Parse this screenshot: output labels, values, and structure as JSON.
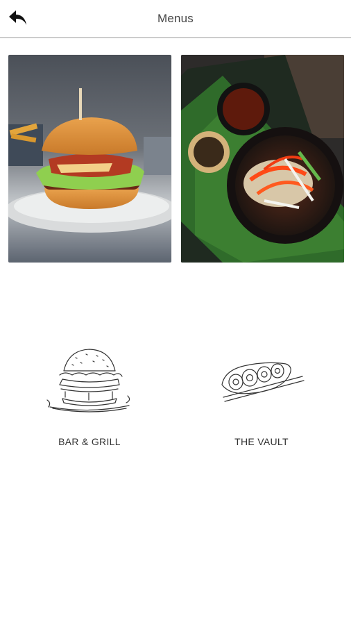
{
  "header": {
    "title": "Menus",
    "back_icon": "back-arrow-icon"
  },
  "photos": [
    {
      "subject": "burger"
    },
    {
      "subject": "asian-bowl"
    }
  ],
  "menus": [
    {
      "label": "BAR & GRILL",
      "icon": "burger-sketch-icon"
    },
    {
      "label": "THE VAULT",
      "icon": "sushi-sketch-icon"
    }
  ],
  "colors": {
    "background": "#ffffff",
    "divider": "#9a9a9a",
    "text": "#333333"
  }
}
